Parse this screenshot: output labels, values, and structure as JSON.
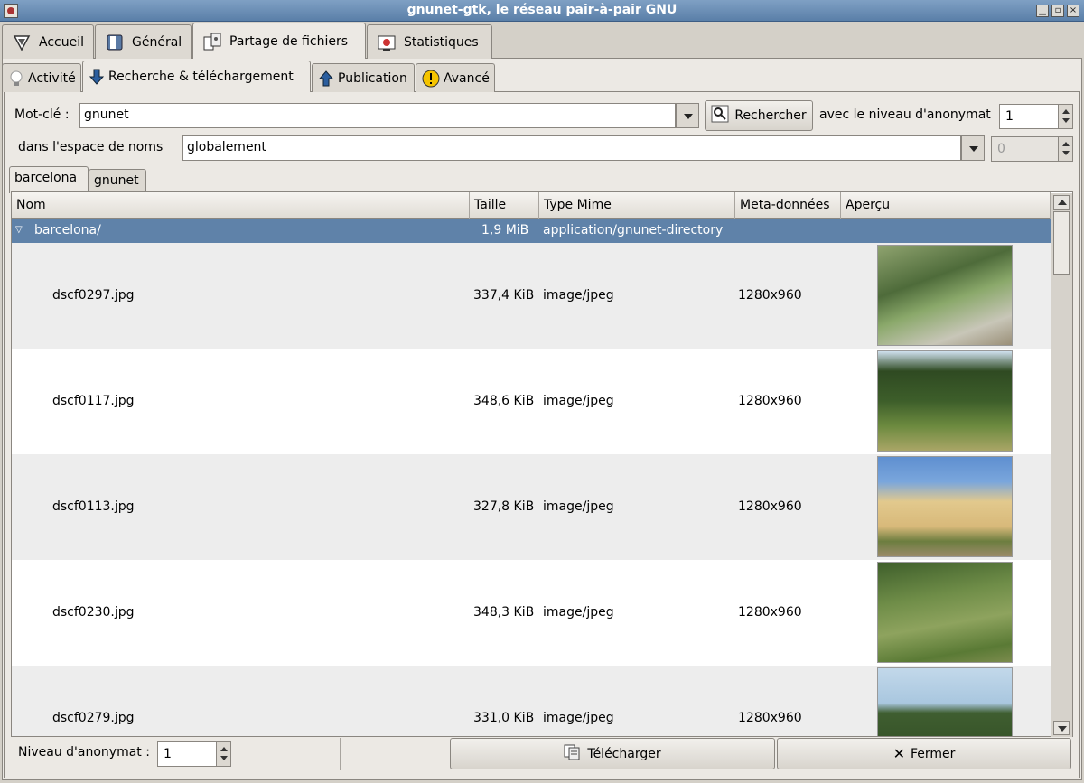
{
  "window": {
    "title": "gnunet-gtk, le réseau pair-à-pair GNU"
  },
  "main_tabs": [
    {
      "label": "Accueil",
      "icon": "gnunet-logo-icon"
    },
    {
      "label": "Général",
      "icon": "book-icon"
    },
    {
      "label": "Partage de fichiers",
      "icon": "file-sharing-icon",
      "active": true
    },
    {
      "label": "Statistiques",
      "icon": "statistics-icon"
    }
  ],
  "sub_tabs": [
    {
      "label": "Activité",
      "icon": "lightbulb-icon"
    },
    {
      "label": "Recherche & téléchargement",
      "icon": "down-arrow-icon",
      "active": true
    },
    {
      "label": "Publication",
      "icon": "up-arrow-icon"
    },
    {
      "label": "Avancé",
      "icon": "warning-icon"
    }
  ],
  "search": {
    "keyword_label": "Mot-clé :",
    "keyword_value": "gnunet",
    "search_button": "Rechercher",
    "anonymity_label": "avec le niveau d'anonymat",
    "anonymity_value": "1",
    "namespace_label": "dans l'espace de noms",
    "namespace_value": "globalement",
    "namespace_spin_value": "0"
  },
  "result_tabs": [
    {
      "label": "barcelona",
      "active": true
    },
    {
      "label": "gnunet"
    }
  ],
  "columns": [
    "Nom",
    "Taille",
    "Type Mime",
    "Meta-données",
    "Aperçu"
  ],
  "rows": [
    {
      "name": "barcelona/",
      "size": "1,9 MiB",
      "mime": "application/gnunet-directory",
      "meta": "",
      "selected": true
    },
    {
      "name": "dscf0297.jpg",
      "size": "337,4 KiB",
      "mime": "image/jpeg",
      "meta": "1280x960"
    },
    {
      "name": "dscf0117.jpg",
      "size": "348,6 KiB",
      "mime": "image/jpeg",
      "meta": "1280x960"
    },
    {
      "name": "dscf0113.jpg",
      "size": "327,8 KiB",
      "mime": "image/jpeg",
      "meta": "1280x960"
    },
    {
      "name": "dscf0230.jpg",
      "size": "348,3 KiB",
      "mime": "image/jpeg",
      "meta": "1280x960"
    },
    {
      "name": "dscf0279.jpg",
      "size": "331,0 KiB",
      "mime": "image/jpeg",
      "meta": "1280x960"
    }
  ],
  "bottom": {
    "anonymity_label": "Niveau d'anonymat :",
    "anonymity_value": "1",
    "download_button": "Télécharger",
    "close_button": "Fermer"
  }
}
